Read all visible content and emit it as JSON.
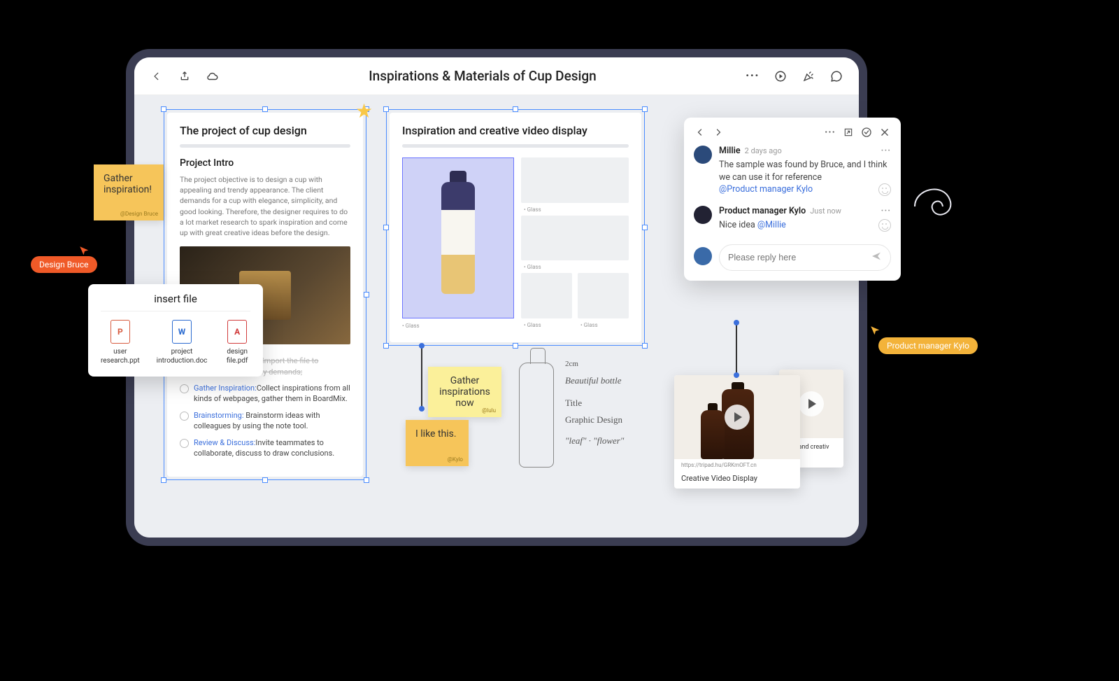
{
  "header": {
    "title": "Inspirations & Materials of Cup Design"
  },
  "cards": {
    "project": {
      "title": "The project of cup design",
      "intro_heading": "Project Intro",
      "intro_text": "The project objective is to design a cup with appealing and trendy appearance. The client demands for a cup with elegance, simplicity, and good looking. Therefore, the designer requires to do a lot market research to spark inspiration and come up with great creative ideas before the design.",
      "checklist": [
        {
          "done": true,
          "text": "Organize Thoughts: Import the file to BoardMix, extract key demands;"
        },
        {
          "done": false,
          "link": "Gather Inspiration:",
          "text": "Collect inspirations from all kinds of webpages, gather them in BoardMix."
        },
        {
          "done": false,
          "link": "Brainstorming:",
          "text": " Brainstorm ideas with colleagues by using the note tool."
        },
        {
          "done": false,
          "link": "Review & Discuss:",
          "text": "Invite teammates to collaborate, discuss to draw conclusions."
        }
      ]
    },
    "inspiration": {
      "title": "Inspiration and creative video display",
      "main_label": "• Glass",
      "thumbs": [
        "• Glass",
        "• Glass",
        "• Glass",
        "• Glass"
      ]
    }
  },
  "sticky": {
    "gather1": {
      "text": "Gather inspiration!",
      "credit": "@Design Bruce"
    },
    "gather2": {
      "text": "Gather inspirations now",
      "credit": "@lulu"
    },
    "like": {
      "text": "I like this.",
      "credit": "@Kylo"
    }
  },
  "insertFile": {
    "title": "insert file",
    "files": [
      {
        "type": "ppt",
        "glyph": "P",
        "name": "user research.ppt"
      },
      {
        "type": "doc",
        "glyph": "W",
        "name": "project introduction.doc"
      },
      {
        "type": "pdf",
        "glyph": "A",
        "name": "design file.pdf"
      }
    ]
  },
  "cursors": {
    "bruce": "Design Bruce",
    "kylo": "Product manager Kylo"
  },
  "comments": {
    "items": [
      {
        "avatar_color": "#2b4a7a",
        "name": "Millie",
        "time": "2 days ago",
        "text": "The sample was found by Bruce, and I think we can use it for reference",
        "mention": "@Product manager Kylo"
      },
      {
        "avatar_color": "#223",
        "name": "Product manager Kylo",
        "time": "Just now",
        "text": "Nice idea ",
        "mention": "@Millie"
      }
    ],
    "reply_placeholder": "Please reply here",
    "input_avatar_color": "#3a6aa8"
  },
  "sketch": {
    "dim": "2cm",
    "line1": "Beautiful bottle",
    "line2": "Title",
    "line3": "Graphic Design",
    "line4": "\"leaf\" · \"flower\""
  },
  "video": {
    "url": "https://tripad.hu/GRKmOFT.cn",
    "caption": "Creative Video Display",
    "caption2": "tion and creativ"
  }
}
